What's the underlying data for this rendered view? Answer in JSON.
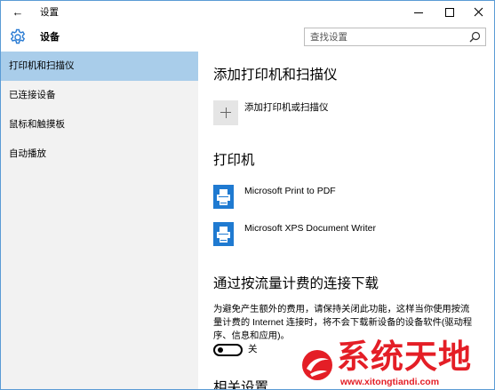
{
  "window": {
    "title": "设置",
    "border_color": "#5a9bd5",
    "controls": {
      "back_icon": "back-arrow-icon",
      "minimize_icon": "minimize-icon",
      "maximize_icon": "maximize-icon",
      "close_icon": "close-icon"
    }
  },
  "header": {
    "icon": "gear-icon",
    "title": "设备",
    "search_placeholder": "查找设置",
    "search_icon": "search-icon"
  },
  "sidebar": {
    "items": [
      {
        "label": "打印机和扫描仪",
        "selected": true
      },
      {
        "label": "已连接设备",
        "selected": false
      },
      {
        "label": "鼠标和触摸板",
        "selected": false
      },
      {
        "label": "自动播放",
        "selected": false
      }
    ]
  },
  "main": {
    "add_section": {
      "heading": "添加打印机和扫描仪",
      "button_icon": "plus-icon",
      "button_label": "添加打印机或扫描仪"
    },
    "printers_section": {
      "heading": "打印机",
      "printers": [
        {
          "name": "Microsoft Print to PDF",
          "icon": "printer-icon"
        },
        {
          "name": "Microsoft XPS Document Writer",
          "icon": "printer-icon"
        }
      ]
    },
    "metered_section": {
      "heading": "通过按流量计费的连接下载",
      "description": "为避免产生额外的费用，请保持关闭此功能，这样当你使用按流量计费的 Internet 连接时，将不会下载新设备的设备软件(驱动程序、信息和应用)。",
      "toggle_on": false,
      "toggle_label": "关"
    },
    "related_section": {
      "heading": "相关设置"
    }
  },
  "watermark": {
    "text": "系统天地",
    "url": "www.xitongtiandi.com",
    "color": "#e41e26"
  },
  "colors": {
    "accent": "#2b7cd3",
    "sidebar_bg": "#f2f2f2",
    "selected_bg": "#a9cdea",
    "printer_icon": "#1f7ad1"
  }
}
